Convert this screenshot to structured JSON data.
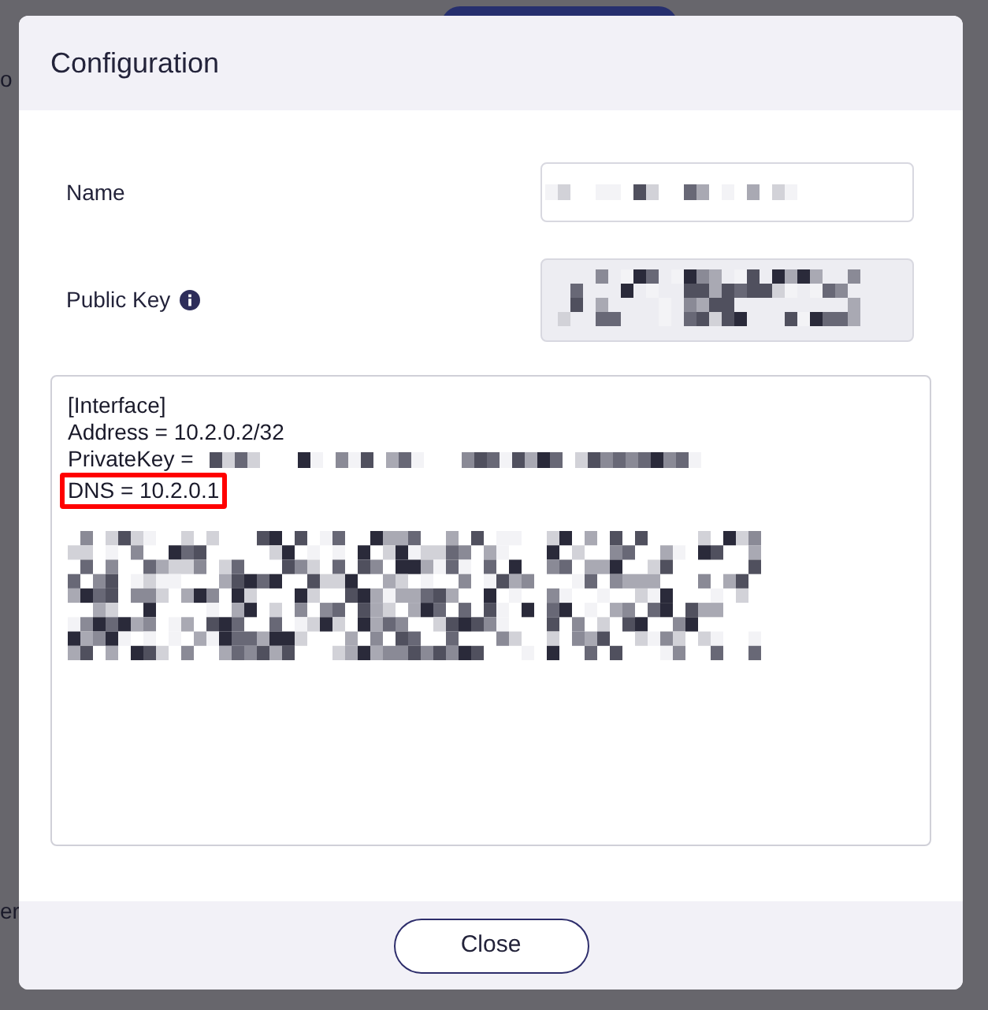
{
  "background": {
    "left_texts": [
      "o",
      "er"
    ]
  },
  "dialog": {
    "title": "Configuration",
    "fields": [
      {
        "label": "Name",
        "kind": "input",
        "info": false
      },
      {
        "label": "Public Key",
        "kind": "textarea",
        "info": true
      }
    ],
    "config_lines": [
      {
        "text": "[Interface]",
        "highlighted": false,
        "redacted": false
      },
      {
        "text": "Address = 10.2.0.2/32",
        "highlighted": false,
        "redacted": false
      },
      {
        "text": "PrivateKey =",
        "highlighted": false,
        "redacted": true
      },
      {
        "text": "DNS = 10.2.0.1",
        "highlighted": true,
        "redacted": false
      }
    ],
    "close_button": "Close"
  }
}
